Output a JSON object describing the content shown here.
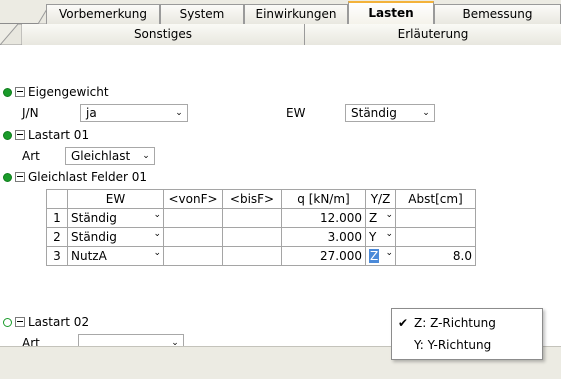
{
  "top_tabs": [
    {
      "label": "Vorbemerkung",
      "active": false
    },
    {
      "label": "System",
      "active": false
    },
    {
      "label": "Einwirkungen",
      "active": false
    },
    {
      "label": "Lasten",
      "active": true
    },
    {
      "label": "Bemessung",
      "active": false
    }
  ],
  "sub_tabs": [
    {
      "label": "Sonstiges"
    },
    {
      "label": "Erläuterung"
    }
  ],
  "eigengewicht": {
    "title": "Eigengewicht",
    "jn_label": "J/N",
    "jn_value": "ja",
    "ew_label": "EW",
    "ew_value": "Ständig"
  },
  "lastart01": {
    "title": "Lastart 01",
    "art_label": "Art",
    "art_value": "Gleichlast"
  },
  "gleichlast": {
    "title": "Gleichlast Felder 01",
    "headers": [
      "EW",
      "<vonF>",
      "<bisF>",
      "q [kN/m]",
      "Y/Z",
      "Abst[cm]"
    ],
    "rows": [
      {
        "n": "1",
        "ew": "Ständig",
        "vonF": "",
        "bisF": "",
        "q": "12.000",
        "yz": "Z",
        "abst": ""
      },
      {
        "n": "2",
        "ew": "Ständig",
        "vonF": "",
        "bisF": "",
        "q": "3.000",
        "yz": "Y",
        "abst": ""
      },
      {
        "n": "3",
        "ew": "NutzA",
        "vonF": "",
        "bisF": "",
        "q": "27.000",
        "yz": "Z",
        "abst": "8.0"
      }
    ]
  },
  "lastart02": {
    "title": "Lastart 02",
    "art_label": "Art",
    "art_value": ""
  },
  "popup": {
    "items": [
      {
        "label": "Z: Z-Richtung",
        "checked": true
      },
      {
        "label": "Y: Y-Richtung",
        "checked": false
      }
    ],
    "check_glyph": "✔"
  },
  "icons": {
    "dropdown": "chevron-down-icon",
    "collapse": "minus-box-icon",
    "status_filled": "green-dot-icon",
    "status_empty": "green-ring-icon"
  },
  "colors": {
    "active_tab_accent": "#f3b23a",
    "status_green": "#1a9b2a",
    "selection_blue": "#4b8ad9"
  }
}
